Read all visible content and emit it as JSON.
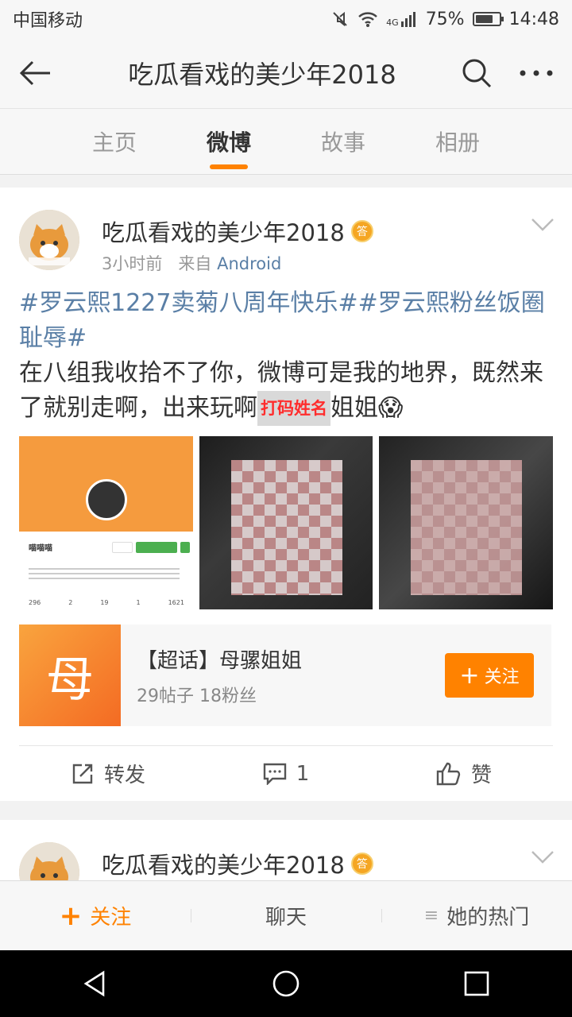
{
  "status_bar": {
    "carrier": "中国移动",
    "network": "4G",
    "battery": "75%",
    "battery_level": 0.75,
    "time": "14:48"
  },
  "header": {
    "title": "吃瓜看戏的美少年2018"
  },
  "tabs": [
    {
      "label": "主页"
    },
    {
      "label": "微博",
      "active": true
    },
    {
      "label": "故事"
    },
    {
      "label": "相册"
    }
  ],
  "post": {
    "username": "吃瓜看戏的美少年2018",
    "badge": "答",
    "time": "3小时前",
    "from_label": "来自",
    "source": "Android",
    "hashtags": "#罗云熙1227卖菊八周年快乐##罗云熙粉丝饭圈耻辱#",
    "body_before": "在八组我收拾不了你，微博可是我的地界，既然来了就别走啊，出来玩啊",
    "censor_label": "打码姓名",
    "body_after": "姐姐",
    "emoji": "😱",
    "photo1": {
      "name": "喵喵喵",
      "nums": [
        "296",
        "2",
        "19",
        "1",
        "1621"
      ]
    },
    "super_topic": {
      "icon_char": "母",
      "title": "【超话】母骡姐姐",
      "stats": "29帖子 18粉丝",
      "follow_label": "关注"
    },
    "actions": {
      "repost": "转发",
      "comment": "1",
      "like": "赞"
    }
  },
  "post2": {
    "username": "吃瓜看戏的美少年2018",
    "badge": "答"
  },
  "bottom_bar": {
    "follow": "关注",
    "chat": "聊天",
    "hot": "她的热门"
  },
  "colors": {
    "accent": "#ff8200",
    "link": "#5a7fa6"
  }
}
